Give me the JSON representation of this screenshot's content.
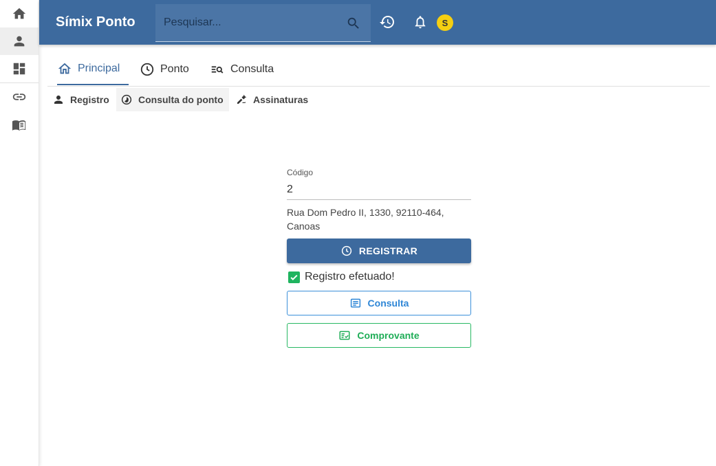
{
  "colors": {
    "primary": "#3d6a9e",
    "avatar": "#f5cf12",
    "success": "#1fb45f",
    "consulta": "#2e86d6",
    "comprovante": "#1fad57"
  },
  "rail": {
    "items": [
      {
        "icon": "home-icon"
      },
      {
        "icon": "person-icon"
      },
      {
        "icon": "dashboard-icon"
      },
      {
        "icon": "link-icon"
      },
      {
        "icon": "book-icon"
      }
    ]
  },
  "header": {
    "title": "Símix Ponto",
    "search_placeholder": "Pesquisar...",
    "avatar_initial": "S"
  },
  "main_tabs": [
    {
      "label": "Principal",
      "icon": "home-outline-icon",
      "active": true
    },
    {
      "label": "Ponto",
      "icon": "clock-icon",
      "active": false
    },
    {
      "label": "Consulta",
      "icon": "list-search-icon",
      "active": false
    }
  ],
  "sub_tabs": [
    {
      "label": "Registro",
      "icon": "person-icon",
      "active": false
    },
    {
      "label": "Consulta do ponto",
      "icon": "timelapse-icon",
      "active": true
    },
    {
      "label": "Assinaturas",
      "icon": "draw-icon",
      "active": false
    }
  ],
  "form": {
    "code_label": "Código",
    "code_value": "2",
    "address": "Rua Dom Pedro II, 1330, 92110-464, Canoas",
    "register_label": "REGISTRAR",
    "success_message": "Registro efetuado!",
    "consulta_label": "Consulta",
    "comprovante_label": "Comprovante"
  }
}
